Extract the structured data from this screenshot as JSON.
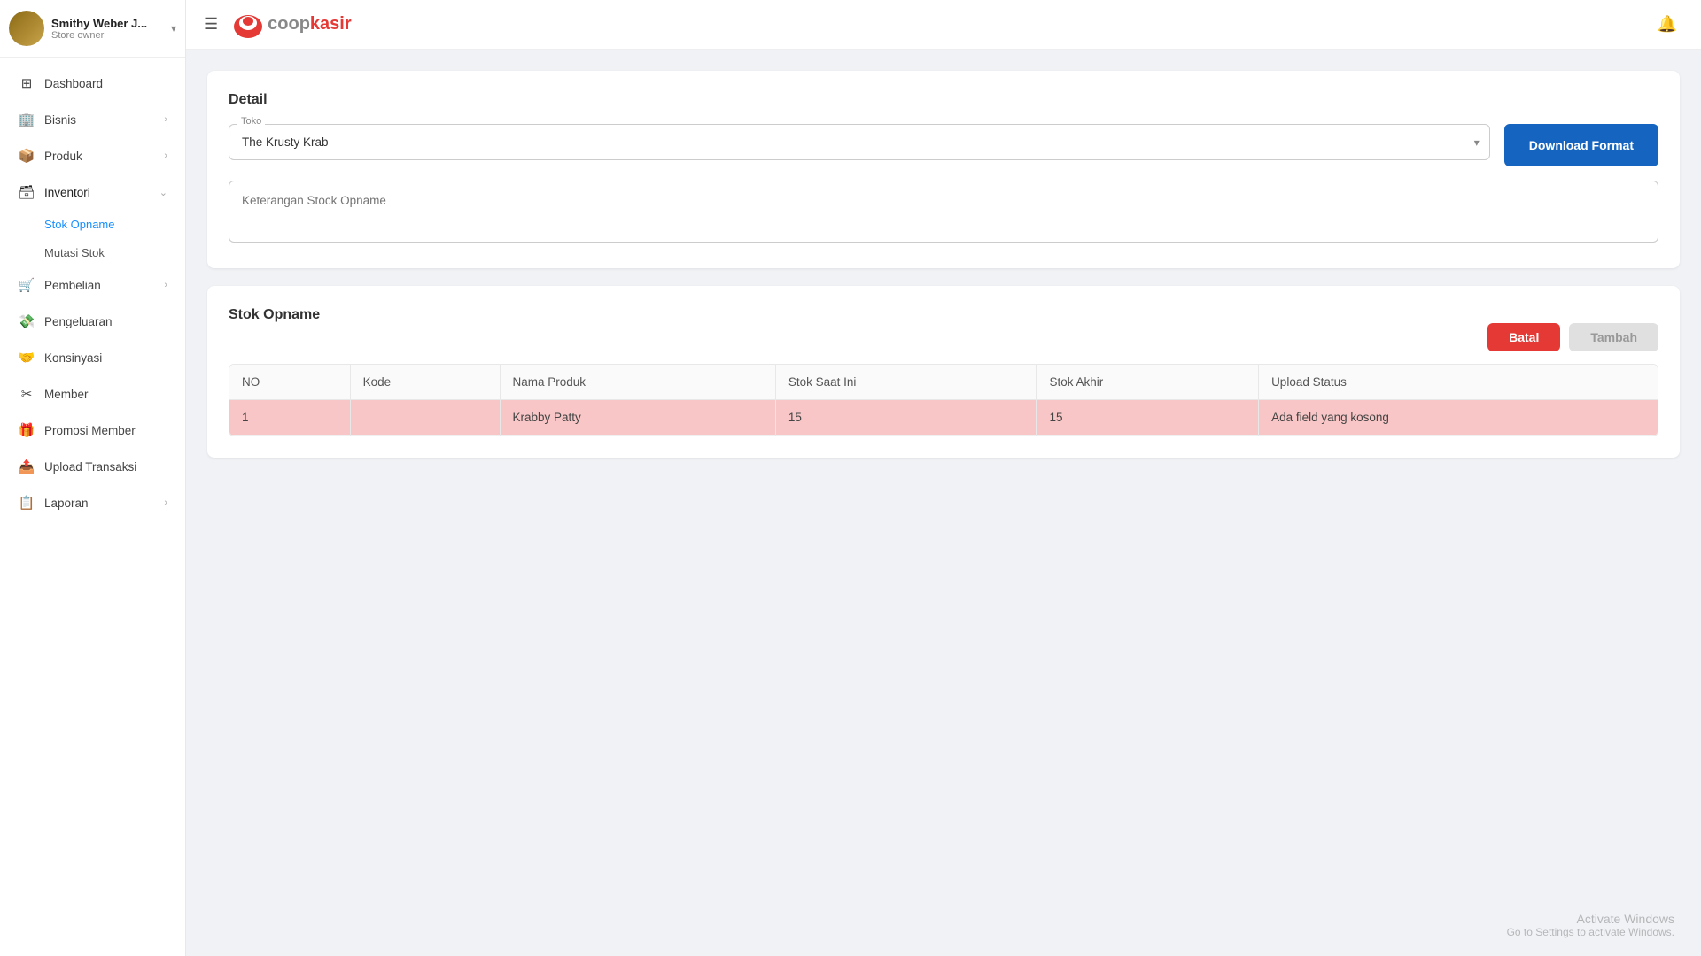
{
  "sidebar": {
    "profile": {
      "name": "Smithy Weber J...",
      "role": "Store owner"
    },
    "nav": [
      {
        "id": "dashboard",
        "label": "Dashboard",
        "icon": "⊞",
        "hasChildren": false
      },
      {
        "id": "bisnis",
        "label": "Bisnis",
        "icon": "🏢",
        "hasChildren": true
      },
      {
        "id": "produk",
        "label": "Produk",
        "icon": "📦",
        "hasChildren": true
      },
      {
        "id": "inventori",
        "label": "Inventori",
        "icon": "🗃",
        "hasChildren": true,
        "expanded": true,
        "children": [
          {
            "id": "stok-opname",
            "label": "Stok Opname",
            "active": true
          },
          {
            "id": "mutasi-stok",
            "label": "Mutasi Stok"
          }
        ]
      },
      {
        "id": "pembelian",
        "label": "Pembelian",
        "icon": "🛒",
        "hasChildren": true
      },
      {
        "id": "pengeluaran",
        "label": "Pengeluaran",
        "icon": "💸",
        "hasChildren": false
      },
      {
        "id": "konsinyasi",
        "label": "Konsinyasi",
        "icon": "🤝",
        "hasChildren": false
      },
      {
        "id": "member",
        "label": "Member",
        "icon": "✂",
        "hasChildren": false
      },
      {
        "id": "promosi-member",
        "label": "Promosi Member",
        "icon": "🎁",
        "hasChildren": false
      },
      {
        "id": "upload-transaksi",
        "label": "Upload Transaksi",
        "icon": "📤",
        "hasChildren": false
      },
      {
        "id": "laporan",
        "label": "Laporan",
        "icon": "📋",
        "hasChildren": true
      }
    ]
  },
  "topbar": {
    "logo_coop": "coop",
    "logo_kasir": "kasir"
  },
  "detail": {
    "section_title": "Detail",
    "toko_label": "Toko",
    "toko_value": "The Krusty Krab",
    "download_btn_label": "Download Format",
    "keterangan_placeholder": "Keterangan Stock Opname"
  },
  "stok_opname": {
    "section_title": "Stok Opname",
    "btn_batal": "Batal",
    "btn_tambah": "Tambah",
    "columns": [
      "NO",
      "Kode",
      "Nama Produk",
      "Stok Saat Ini",
      "Stok Akhir",
      "Upload Status"
    ],
    "rows": [
      {
        "no": "1",
        "kode": "",
        "nama_produk": "Krabby Patty",
        "stok_saat_ini": "15",
        "stok_akhir": "15",
        "upload_status": "Ada field yang kosong",
        "error": true
      }
    ]
  },
  "watermark": {
    "line1": "Activate Windows",
    "line2": "Go to Settings to activate Windows."
  }
}
